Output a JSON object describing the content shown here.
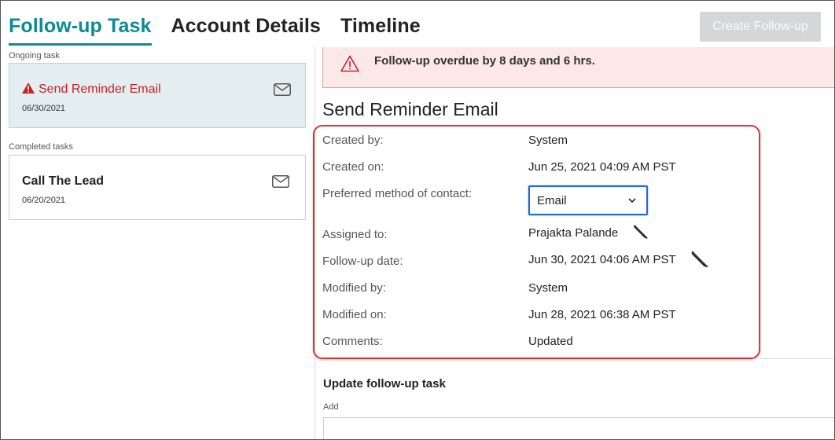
{
  "tabs": [
    {
      "label": "Follow-up Task",
      "active": true
    },
    {
      "label": "Account Details",
      "active": false
    },
    {
      "label": "Timeline",
      "active": false
    }
  ],
  "create_button": "Create Follow-up",
  "left_panel": {
    "ongoing_label": "Ongoing task",
    "completed_label": "Completed tasks",
    "ongoing_tasks": [
      {
        "title": "Send Reminder Email",
        "date": "06/30/2021",
        "icon": "mail-icon",
        "status_icon": "warning-icon"
      }
    ],
    "completed_tasks": [
      {
        "title": "Call The Lead",
        "date": "06/20/2021",
        "icon": "mail-icon"
      }
    ]
  },
  "alert": {
    "text": "Follow-up overdue by 8 days and 6 hrs.",
    "icon": "warning-icon"
  },
  "detail": {
    "title": "Send Reminder Email",
    "rows": [
      {
        "label": "Created by:",
        "value": "System"
      },
      {
        "label": "Created on:",
        "value": "Jun 25, 2021 04:09 AM PST"
      },
      {
        "label": "Preferred method of contact:",
        "value": "Email"
      },
      {
        "label": "Assigned to:",
        "value": "Prajakta Palande"
      },
      {
        "label": "Follow-up date:",
        "value": "Jun 30, 2021 04:06 AM PST"
      },
      {
        "label": "Modified by:",
        "value": "System"
      },
      {
        "label": "Modified on:",
        "value": "Jun 28, 2021 06:38 AM PST"
      },
      {
        "label": "Comments:",
        "value": "Updated"
      }
    ]
  },
  "update": {
    "title": "Update follow-up task",
    "add_label": "Add"
  },
  "colors": {
    "accent": "#0b8b92",
    "overdue": "#cc1f26",
    "alert_bg": "#fde8e8",
    "highlight": "#d8383c",
    "focus": "#1e6ad8"
  }
}
